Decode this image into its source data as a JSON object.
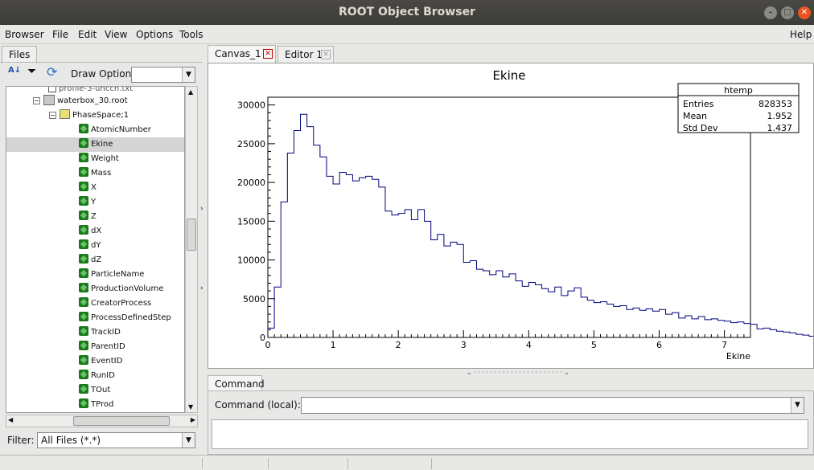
{
  "window": {
    "title": "ROOT Object Browser"
  },
  "menubar": {
    "left": [
      "Browser",
      "File",
      "Edit",
      "View",
      "Options",
      "Tools"
    ],
    "help": "Help"
  },
  "left_panel": {
    "tab": "Files",
    "draw_option_label": "Draw Option:",
    "draw_option_value": "",
    "tree": {
      "partial_top": "profile-3-unccn.txt",
      "file": "waterbox_30.root",
      "tree_node": "PhaseSpace;1",
      "leaves": [
        "AtomicNumber",
        "Ekine",
        "Weight",
        "Mass",
        "X",
        "Y",
        "Z",
        "dX",
        "dY",
        "dZ",
        "ParticleName",
        "ProductionVolume",
        "CreatorProcess",
        "ProcessDefinedStep",
        "TrackID",
        "ParentID",
        "EventID",
        "RunID",
        "TOut",
        "TProd"
      ],
      "selected": "Ekine"
    },
    "filter_label": "Filter:",
    "filter_value": "All Files (*.*)"
  },
  "tabs": {
    "canvas": "Canvas_1",
    "editor": "Editor 1",
    "command": "Command"
  },
  "command": {
    "label": "Command (local):",
    "value": ""
  },
  "stats": {
    "title": "htemp",
    "rows": [
      {
        "label": "Entries",
        "value": "828353"
      },
      {
        "label": "Mean",
        "value": "1.952"
      },
      {
        "label": "Std Dev",
        "value": "1.437"
      }
    ]
  },
  "chart_data": {
    "type": "line",
    "title": "Ekine",
    "xlabel": "Ekine",
    "ylabel": "",
    "xlim": [
      0,
      7.4
    ],
    "ylim": [
      0,
      31000
    ],
    "xticks": [
      "0",
      "1",
      "2",
      "3",
      "4",
      "5",
      "6",
      "7"
    ],
    "yticks": [
      "0",
      "5000",
      "10000",
      "15000",
      "20000",
      "25000",
      "30000"
    ],
    "bin_width": 0.1,
    "values": [
      1200,
      6500,
      17500,
      23800,
      26700,
      28800,
      27200,
      24800,
      23300,
      20800,
      19800,
      21300,
      21000,
      20200,
      20600,
      20800,
      20400,
      19400,
      16300,
      15800,
      16000,
      16500,
      15200,
      16500,
      15000,
      12600,
      13300,
      11800,
      12300,
      12000,
      9700,
      9900,
      8800,
      8600,
      8100,
      8600,
      7800,
      8200,
      7300,
      6600,
      7100,
      6800,
      6300,
      5900,
      6500,
      5400,
      6000,
      6400,
      5200,
      4800,
      4500,
      4600,
      4300,
      4000,
      4100,
      3600,
      3800,
      3500,
      3700,
      3400,
      3600,
      3000,
      3200,
      2500,
      2800,
      2400,
      2700,
      2300,
      2400,
      2200,
      2100,
      1900,
      2000,
      1800,
      1700,
      1100,
      1200,
      1000,
      800,
      700,
      600,
      400,
      300,
      150,
      50
    ],
    "line_color": "#000080",
    "grid": false
  }
}
